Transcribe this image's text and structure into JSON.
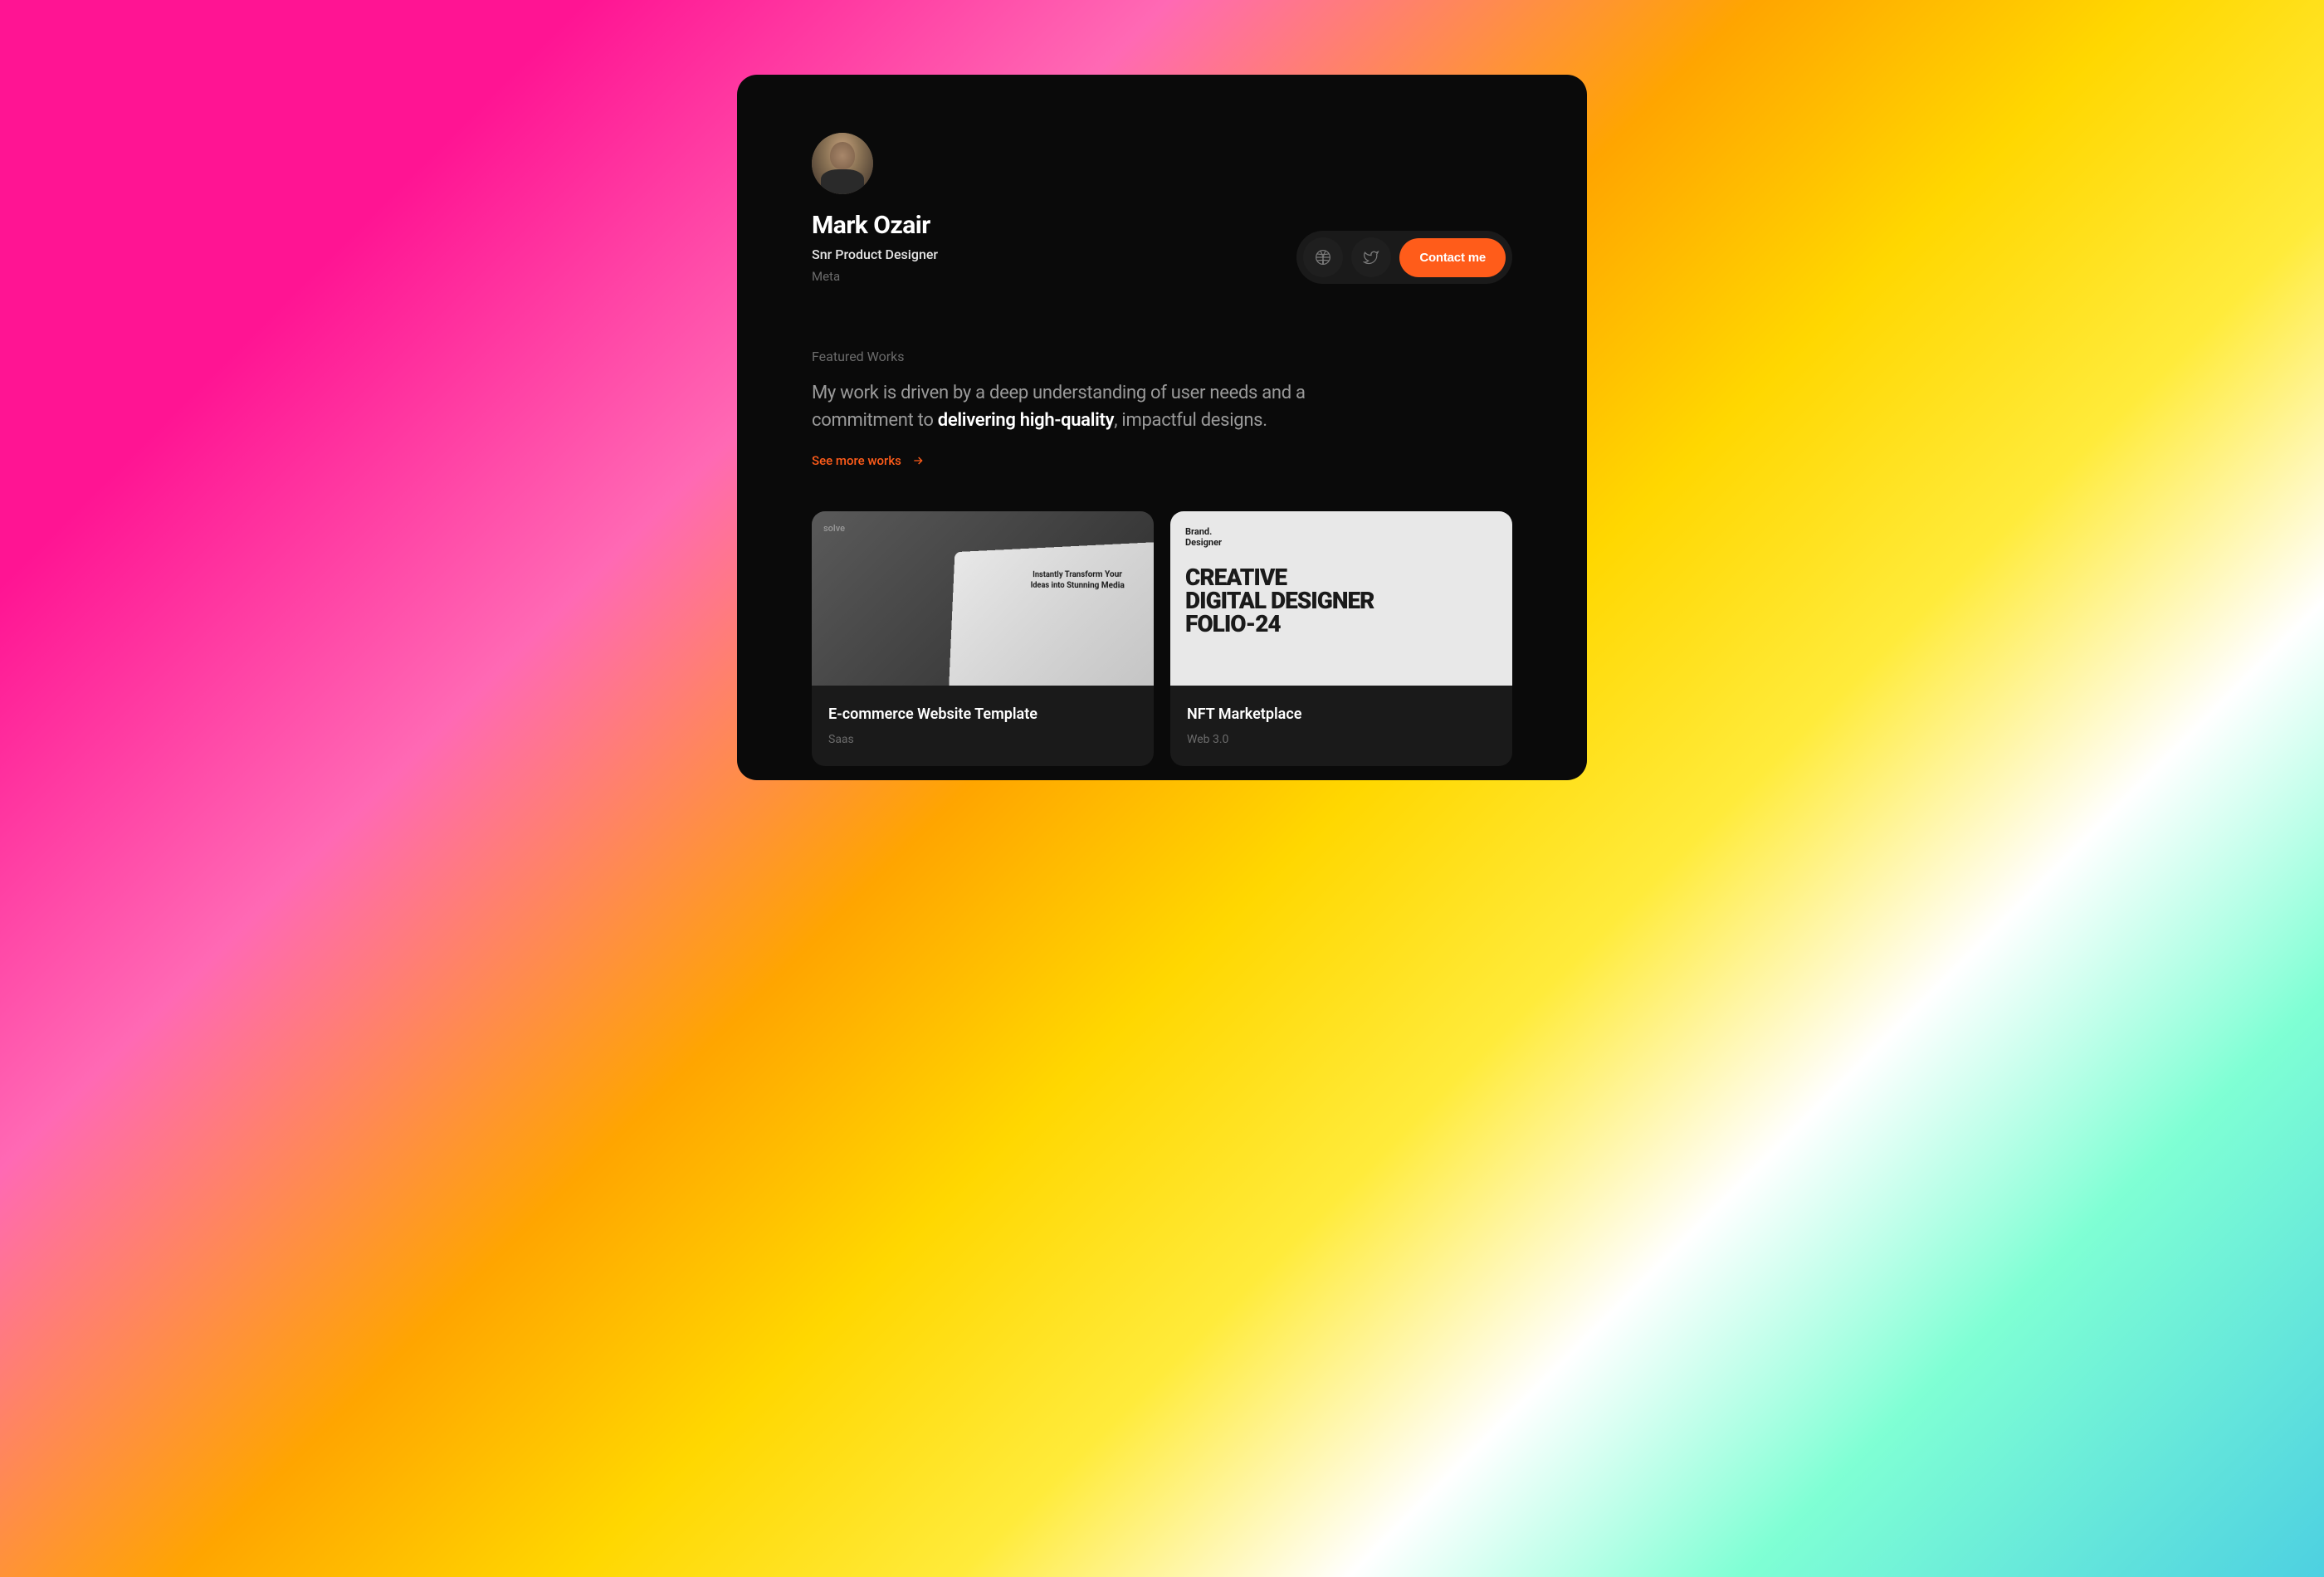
{
  "profile": {
    "name": "Mark Ozair",
    "title": "Snr Product Designer",
    "company": "Meta"
  },
  "actions": {
    "contact_label": "Contact me"
  },
  "works": {
    "section_label": "Featured Works",
    "description_part1": "My work is driven by a deep understanding of user needs and a commitment to ",
    "description_highlight": "delivering high-quality",
    "description_part2": ", impactful designs.",
    "see_more_label": "See more works",
    "items": [
      {
        "title": "E-commerce Website Template",
        "category": "Saas",
        "thumb_label": "solve"
      },
      {
        "title": "NFT Marketplace",
        "category": "Web 3.0",
        "thumb_brand": "Brand.\nDesigner",
        "thumb_headline": "CREATIVE\nDIGITAL DESIGNER\nFOLIO-24"
      }
    ]
  }
}
